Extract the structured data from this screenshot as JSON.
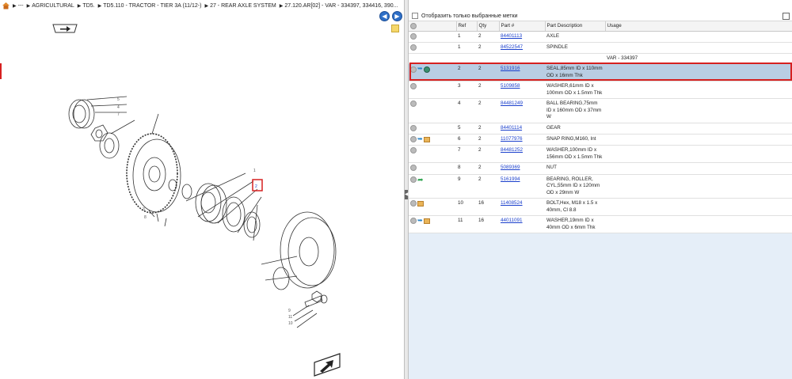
{
  "breadcrumb": [
    "---",
    "AGRICULTURAL",
    "TD5.",
    "TD5.110 - TRACTOR - TIER 3A (11/12-)",
    "27 - REAR AXLE SYSTEM",
    "27.120.AR[02] - VAR - 334397, 334416, 390..."
  ],
  "filter": {
    "label": "Отобразить только выбранные метки"
  },
  "table": {
    "headers": [
      "",
      "Ref",
      "Qty",
      "Part #",
      "Part Description",
      "Usage"
    ],
    "rows": [
      {
        "icons": [
          "gear"
        ],
        "ref": "1",
        "qty": "2",
        "part": "84401113",
        "desc": "AXLE",
        "usage": ""
      },
      {
        "icons": [
          "gear"
        ],
        "ref": "1",
        "qty": "2",
        "part": "84522547",
        "desc": "SPINDLE",
        "usage": ""
      },
      {
        "var": "VAR - 334397"
      },
      {
        "icons": [
          "gear",
          "arrow",
          "globe"
        ],
        "ref": "2",
        "qty": "2",
        "part": "5131916",
        "desc": "SEAL,85mm ID x 110mm OD x 16mm Thk",
        "usage": "",
        "selected": true
      },
      {
        "icons": [
          "gear"
        ],
        "ref": "3",
        "qty": "2",
        "part": "5109858",
        "desc": "WASHER,61mm ID x 100mm OD x 1.5mm Thk",
        "usage": ""
      },
      {
        "icons": [
          "gear"
        ],
        "ref": "4",
        "qty": "2",
        "part": "84481249",
        "desc": "BALL BEARING,75mm ID x 160mm OD x 37mm W",
        "usage": ""
      },
      {
        "icons": [
          "gear"
        ],
        "ref": "5",
        "qty": "2",
        "part": "84401114",
        "desc": "GEAR",
        "usage": ""
      },
      {
        "icons": [
          "gear",
          "arrow",
          "box"
        ],
        "ref": "6",
        "qty": "2",
        "part": "11077976",
        "desc": "SNAP RING,M160, Int",
        "usage": ""
      },
      {
        "icons": [
          "gear"
        ],
        "ref": "7",
        "qty": "2",
        "part": "84481252",
        "desc": "WASHER,100mm ID x 156mm OD x 1.5mm Thk",
        "usage": ""
      },
      {
        "icons": [
          "gear"
        ],
        "ref": "8",
        "qty": "2",
        "part": "5089369",
        "desc": "NUT",
        "usage": ""
      },
      {
        "icons": [
          "gear",
          "greenarrow"
        ],
        "ref": "9",
        "qty": "2",
        "part": "5161994",
        "desc": "BEARING, ROLLER, CYL,55mm ID x 120mm OD x 29mm W",
        "usage": ""
      },
      {
        "icons": [
          "gear",
          "box"
        ],
        "ref": "10",
        "qty": "16",
        "part": "11408524",
        "desc": "BOLT,Hex, M18 x 1.5 x 40mm, Cl 8.8",
        "usage": ""
      },
      {
        "icons": [
          "gear",
          "arrow",
          "box"
        ],
        "ref": "11",
        "qty": "16",
        "part": "44011091",
        "desc": "WASHER,19mm ID x 40mm OD x 6mm Thk",
        "usage": ""
      }
    ]
  },
  "diagram": {
    "callouts": [
      "1",
      "2",
      "3",
      "4",
      "5",
      "6",
      "7",
      "8",
      "9",
      "10",
      "11"
    ]
  }
}
